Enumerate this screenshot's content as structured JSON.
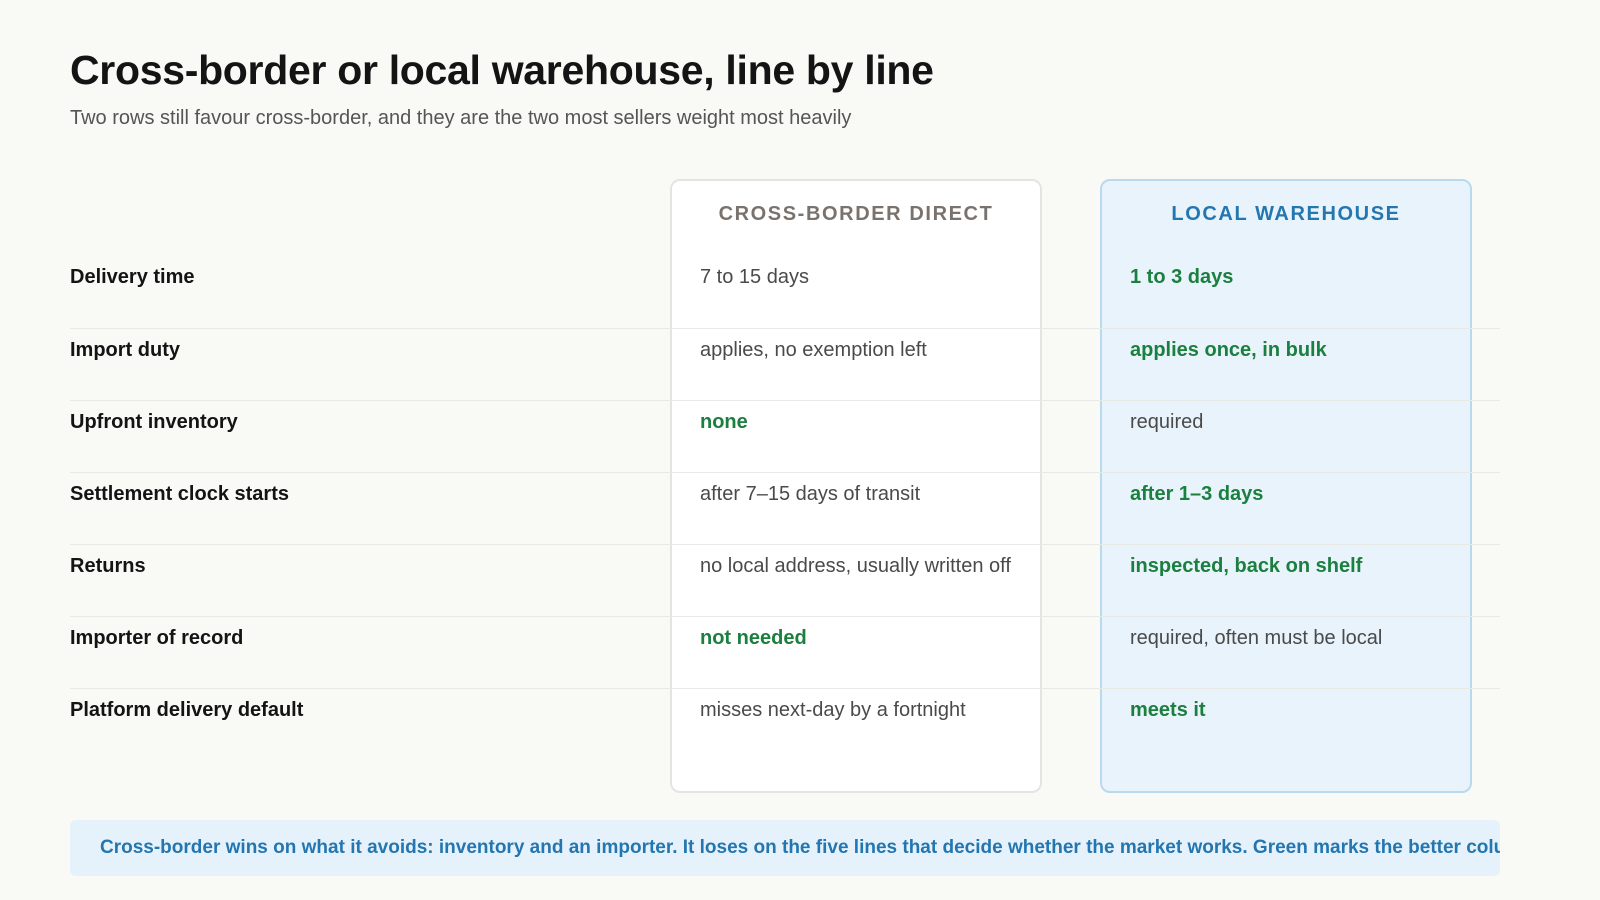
{
  "header": {
    "title": "Cross-border or local warehouse, line by line",
    "subtitle": "Two rows still favour cross-border, and they are the two most sellers weight most heavily"
  },
  "columns": {
    "cross_border": "CROSS-BORDER DIRECT",
    "local_warehouse": "LOCAL WAREHOUSE"
  },
  "colors": {
    "better": "#1b7f3f",
    "accent": "#2476b0",
    "highlight_bg": "#e8f3fb"
  },
  "rows": [
    {
      "label": "Delivery time",
      "cross_border": "7 to 15 days",
      "local_warehouse": "1 to 3 days",
      "better": "local_warehouse"
    },
    {
      "label": "Import duty",
      "cross_border": "applies, no exemption left",
      "local_warehouse": "applies once, in bulk",
      "better": "local_warehouse"
    },
    {
      "label": "Upfront inventory",
      "cross_border": "none",
      "local_warehouse": "required",
      "better": "cross_border"
    },
    {
      "label": "Settlement clock starts",
      "cross_border": "after 7–15 days of transit",
      "local_warehouse": "after 1–3 days",
      "better": "local_warehouse"
    },
    {
      "label": "Returns",
      "cross_border": "no local address, usually written off",
      "local_warehouse": "inspected, back on shelf",
      "better": "local_warehouse"
    },
    {
      "label": "Importer of record",
      "cross_border": "not needed",
      "local_warehouse": "required, often must be local",
      "better": "cross_border"
    },
    {
      "label": "Platform delivery default",
      "cross_border": "misses next-day by a fortnight",
      "local_warehouse": "meets it",
      "better": "local_warehouse"
    }
  ],
  "note": "Cross-border wins on what it avoids: inventory and an importer. It loses on the five lines that decide whether the market works. Green marks the better column"
}
